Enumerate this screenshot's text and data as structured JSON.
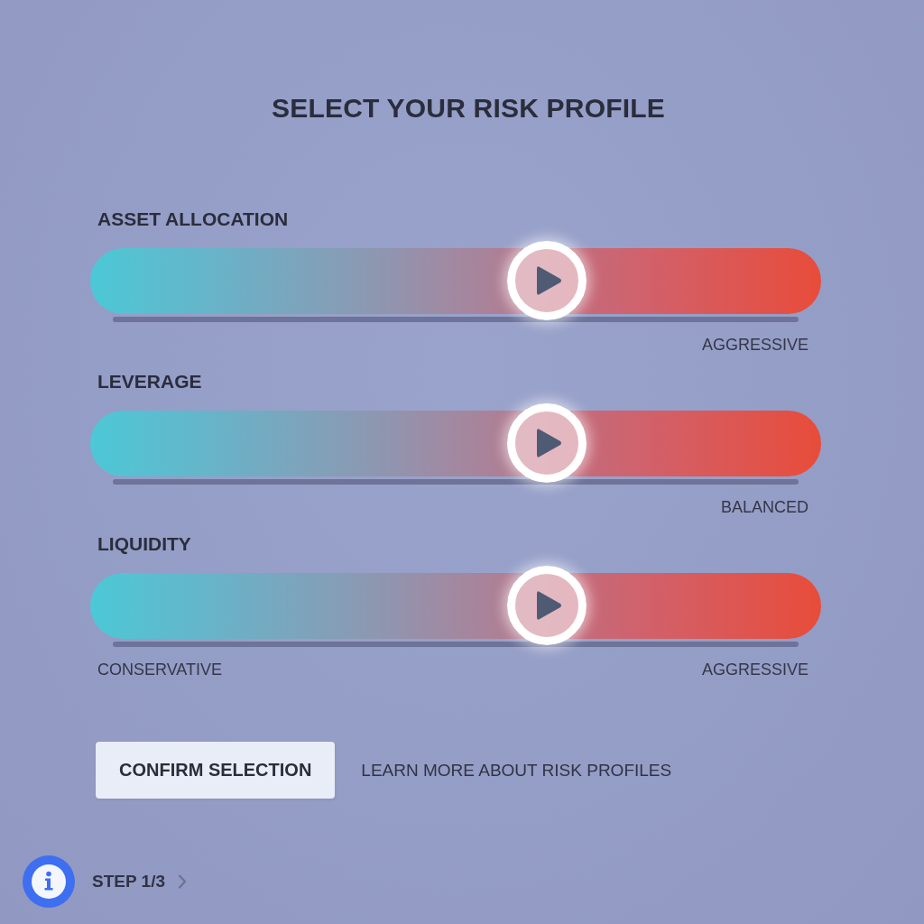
{
  "title": "SELECT YOUR RISK PROFILE",
  "sliders": [
    {
      "label": "ASSET ALLOCATION",
      "level": 0.64,
      "max_label": "AGGRESSIVE"
    },
    {
      "label": "LEVERAGE",
      "level": 0.64,
      "max_label": "BALANCED"
    },
    {
      "label": "LIQUIDITY",
      "level": 0.64,
      "min_label": "CONSERVATIVE",
      "max_label": "AGGRESSIVE"
    }
  ],
  "actions": {
    "confirm_button": "CONFIRM SELECTION",
    "learn_more_link": "LEARN MORE ABOUT RISK PROFILES"
  },
  "footer": {
    "step": "STEP 1/3"
  }
}
